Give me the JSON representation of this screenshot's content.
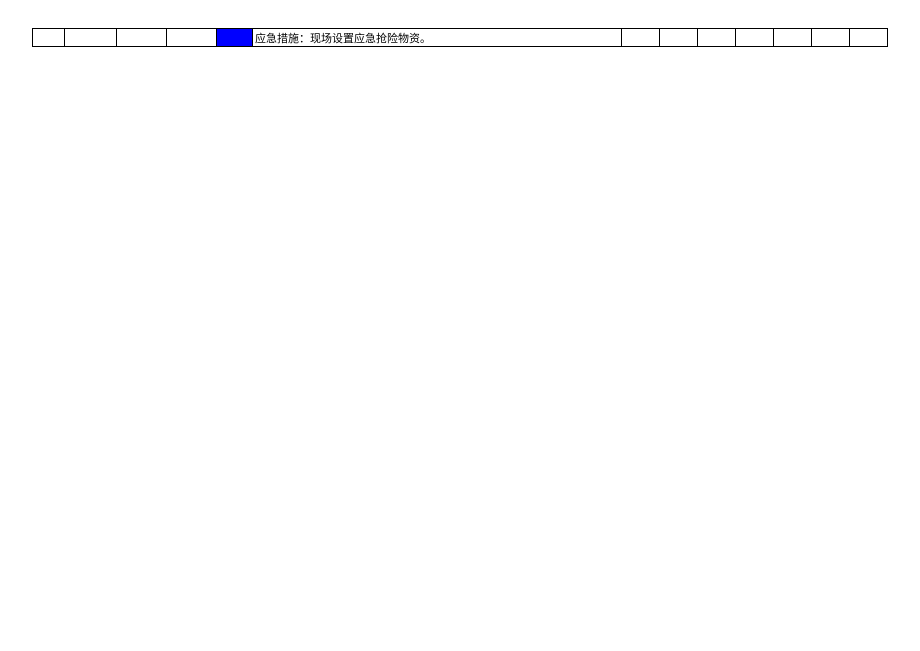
{
  "table": {
    "row": {
      "blue_cell": "",
      "text_content": "应急措施：现场设置应急抢险物资。"
    }
  }
}
